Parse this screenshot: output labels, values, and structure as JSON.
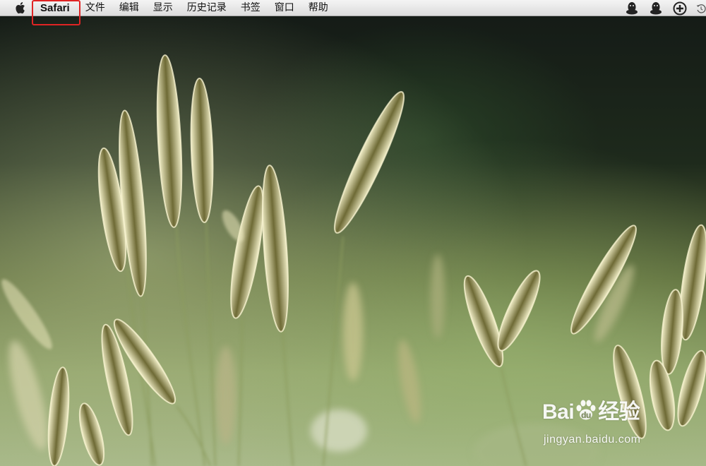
{
  "menubar": {
    "apple_icon": "apple-logo-icon",
    "app_name": "Safari",
    "items": [
      "文件",
      "编辑",
      "显示",
      "历史记录",
      "书签",
      "窗口",
      "帮助"
    ],
    "status_icons": [
      "qq-penguin-icon",
      "qq-penguin-icon",
      "add-circle-icon",
      "time-machine-icon"
    ]
  },
  "annotation": {
    "color": "#e02424",
    "target": "Safari"
  },
  "wallpaper": {
    "subject": "foxtail-grass"
  },
  "watermark": {
    "logo_text_left": "Bai",
    "logo_text_right": "经验",
    "url": "jingyan.baidu.com"
  }
}
